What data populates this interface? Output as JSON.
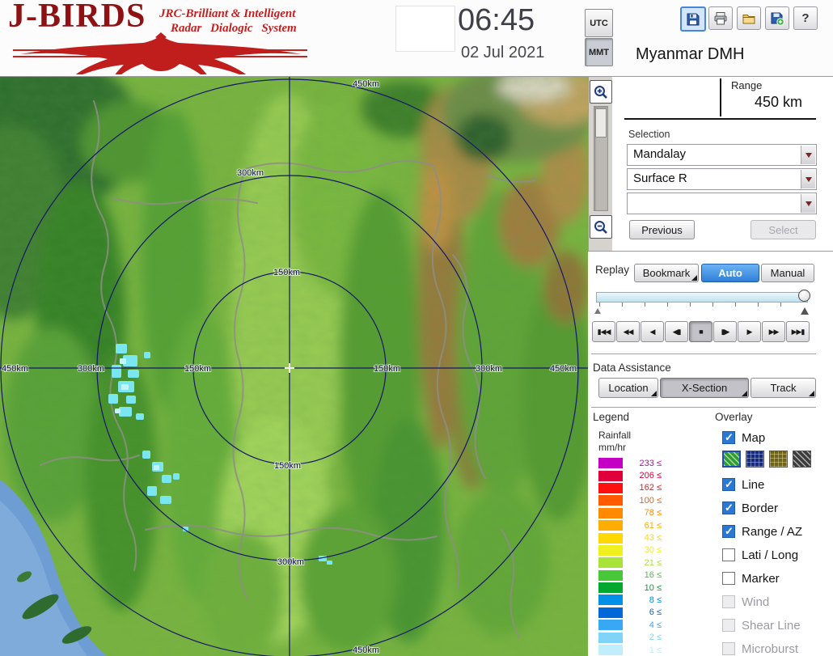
{
  "header": {
    "logo": {
      "title": "J-BIRDS",
      "subtitle_line1": "JRC-Brilliant & Intelligent",
      "subtitle_line2": "Radar Dialogic System"
    },
    "clock": {
      "time": "06:45",
      "date": "02 Jul 2021"
    },
    "timezone": {
      "utc_label": "UTC",
      "mmt_label": "MMT",
      "selected": "MMT"
    },
    "toolbar": {
      "help_glyph": "?"
    },
    "station_title": "Myanmar DMH"
  },
  "range_panel": {
    "label": "Range",
    "value": "450 km"
  },
  "selection_panel": {
    "label": "Selection",
    "dropdowns": [
      {
        "value": "Mandalay"
      },
      {
        "value": "Surface R"
      },
      {
        "value": ""
      }
    ],
    "previous_label": "Previous",
    "select_label": "Select"
  },
  "replay_panel": {
    "label": "Replay",
    "bookmark_label": "Bookmark",
    "auto_label": "Auto",
    "manual_label": "Manual",
    "selected_mode": "Auto",
    "playback": [
      {
        "name": "skip-start",
        "glyph": "▮◀◀"
      },
      {
        "name": "fast-rewind",
        "glyph": "◀◀"
      },
      {
        "name": "play-reverse",
        "glyph": "◀"
      },
      {
        "name": "step-back",
        "glyph": "◀▮"
      },
      {
        "name": "stop",
        "glyph": "■"
      },
      {
        "name": "step-forward",
        "glyph": "▮▶"
      },
      {
        "name": "play",
        "glyph": "▶"
      },
      {
        "name": "fast-forward",
        "glyph": "▶▶"
      },
      {
        "name": "skip-end",
        "glyph": "▶▶▮"
      }
    ]
  },
  "data_assistance": {
    "label": "Data Assistance",
    "location_label": "Location",
    "xsection_label": "X-Section",
    "track_label": "Track"
  },
  "legend": {
    "title": "Legend",
    "unit_line1": "Rainfall",
    "unit_line2": "mm/hr",
    "scale": [
      {
        "label": "233 ≤",
        "color": "#C400C4"
      },
      {
        "label": "206 ≤",
        "color": "#E0003C"
      },
      {
        "label": "162 ≤",
        "color": "#FF1010"
      },
      {
        "label": "100 ≤",
        "color": "#FF5A00"
      },
      {
        "label": "78 ≤",
        "color": "#FF8A00"
      },
      {
        "label": "61 ≤",
        "color": "#FFAE00"
      },
      {
        "label": "43 ≤",
        "color": "#FFD800"
      },
      {
        "label": "30 ≤",
        "color": "#F0F01E"
      },
      {
        "label": "21 ≤",
        "color": "#A8E438"
      },
      {
        "label": "16 ≤",
        "color": "#48C838"
      },
      {
        "label": "10 ≤",
        "color": "#00A830"
      },
      {
        "label": "8 ≤",
        "color": "#0090E8"
      },
      {
        "label": "6 ≤",
        "color": "#0068D8"
      },
      {
        "label": "4 ≤",
        "color": "#38A8F4"
      },
      {
        "label": "2 ≤",
        "color": "#80D4F8"
      },
      {
        "label": "1 ≤",
        "color": "#C0EEFC"
      }
    ]
  },
  "overlay": {
    "title": "Overlay",
    "map_styles": [
      {
        "name": "green-hatch",
        "color": "#2F9E2F",
        "selected": true
      },
      {
        "name": "navy-grid",
        "color": "#162B7E",
        "selected": false
      },
      {
        "name": "olive-grid",
        "color": "#6F6314",
        "selected": false
      },
      {
        "name": "charcoal-hatch",
        "color": "#3C3C3C",
        "selected": false
      }
    ],
    "items": [
      {
        "label": "Map",
        "checked": true,
        "enabled": true
      },
      {
        "label": "Line",
        "checked": true,
        "enabled": true
      },
      {
        "label": "Border",
        "checked": true,
        "enabled": true
      },
      {
        "label": "Range / AZ",
        "checked": true,
        "enabled": true
      },
      {
        "label": "Lati / Long",
        "checked": false,
        "enabled": true
      },
      {
        "label": "Marker",
        "checked": false,
        "enabled": true
      },
      {
        "label": "Wind",
        "checked": false,
        "enabled": false
      },
      {
        "label": "Shear Line",
        "checked": false,
        "enabled": false
      },
      {
        "label": "Microburst",
        "checked": false,
        "enabled": false
      }
    ]
  },
  "map": {
    "ring_label_150": "150km",
    "ring_label_300": "300km",
    "ring_label_450": "450km"
  },
  "colors": {
    "logo_red": "#C01D1D",
    "accent_selection_blue": "#2F7FD8",
    "checkbox_blue": "#2B78D4"
  }
}
